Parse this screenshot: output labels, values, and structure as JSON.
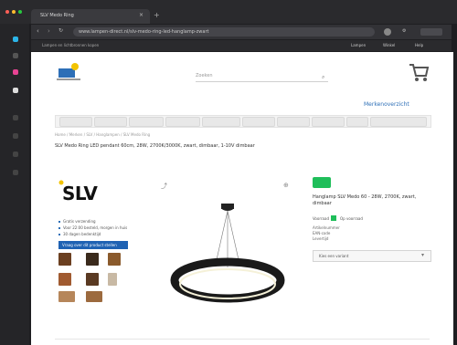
{
  "browser": {
    "tab_title": "SLV Medo Ring",
    "url": "www.lampen-direct.nl/slv-medo-ring-led-hanglamp-zwart",
    "bookmarks_text": "Lampen en lichtbronnen kopen",
    "profile_labels": [
      "Lampen",
      "Winkel",
      "Help"
    ]
  },
  "store": {
    "search_placeholder": "Zoeken",
    "brand_link": "Merkenoverzicht",
    "nav_items": [
      "",
      "",
      "",
      "",
      "",
      "",
      "",
      "",
      "",
      ""
    ],
    "breadcrumb": "Home / Merken / SLV / Hanglampen / SLV Medo Ring",
    "product_title": "SLV Medo Ring LED pendant 60cm, 28W, 2700K/3000K, zwart, dimbaar, 1-10V dimbaar",
    "brand_logo_text": "SLV",
    "feature_bullets": [
      "Gratis verzending",
      "Voor 22:00 besteld, morgen in huis",
      "30 dagen bedenktijd"
    ],
    "action_button": "Vraag over dit product stellen",
    "side_title": "Hanglamp SLV Medo 60 - 28W, 2700K, zwart, dimbaar",
    "stock_label": "Voorraad",
    "stock_status": "Op voorraad",
    "info_lines": [
      "Artikelnummer",
      "EAN-code",
      "Levertijd"
    ],
    "select_label": "Kies een variant"
  },
  "colors": {
    "accent_blue": "#1f62b3",
    "badge_green": "#1fbe5a",
    "link_blue": "#2d6fb7"
  }
}
